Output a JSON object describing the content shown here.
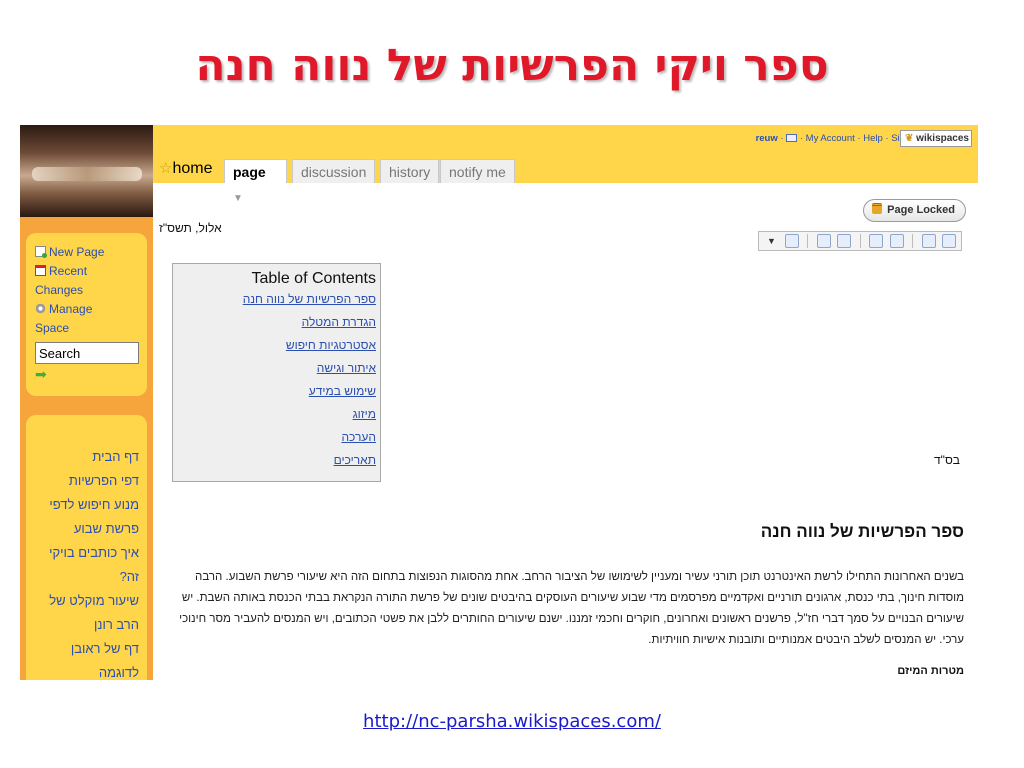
{
  "slide_title": "ספר ויקי הפרשיות של נווה חנה",
  "url": "http://nc-parsha.wikispaces.com/",
  "account": {
    "user": "reuw",
    "my_account": "My Account",
    "help": "Help",
    "sign_out": "Sign Out",
    "brand": "wikispaces"
  },
  "tabs": {
    "home": "home",
    "page": "page",
    "discussion": "discussion",
    "history": "history",
    "notify": "notify me"
  },
  "sidebar": {
    "new_page": "New Page",
    "recent_changes_1": "Recent",
    "recent_changes_2": "Changes",
    "manage_space_1": "Manage",
    "manage_space_2": "Space",
    "search_value": "Search",
    "nav": [
      "דף הבית",
      "דפי הפרשיות",
      "מנוע חיפוש לדפי",
      "פרשת שבוע",
      "איך כותבים בויקי",
      "זה?",
      "שיעור מוקלט של",
      "הרב רונן",
      "דף של ראובן",
      "לדוגמה"
    ]
  },
  "page": {
    "date": "אלול, תשס\"ז",
    "locked": "Page Locked",
    "toc_title": "Table of Contents",
    "toc": [
      "ספר הפרשיות של נווה חנה",
      "הגדרת המטלה",
      "אסטרטגיות חיפוש",
      "איתור וגישה",
      "שימוש במידע",
      "מיזוג",
      "הערכה",
      "תאריכים"
    ],
    "bsd": "בס\"ד",
    "heading": "ספר הפרשיות של נווה חנה",
    "paragraph": "בשנים האחרונות התחילו לרשת האינטרנט תוכן תורני עשיר ומעניין לשימושו של הציבור הרחב. אחת מהסוגות הנפוצות בתחום הזה היא שיעורי פרשת השבוע. הרבה מוסדות חינוך, בתי כנסת, ארגונים תורניים ואקדמיים מפרסמים מדי שבוע שיעורים העוסקים בהיבטים שונים של פרשת התורה הנקראת בבתי הכנסת באותה השבת. יש שיעורים הבנויים על סמך דברי חז\"ל, פרשנים ראשונים ואחרונים, חוקרים וחכמי זמננו. ישנם שיעורים החותרים ללבן את פשטי הכתובים, ויש המנסים להעביר מסר חינוכי ערכי. יש המנסים לשלב היבטים אמנותיים ותובנות אישיות חוויתיות.",
    "goals": "מטרות המיזם"
  }
}
